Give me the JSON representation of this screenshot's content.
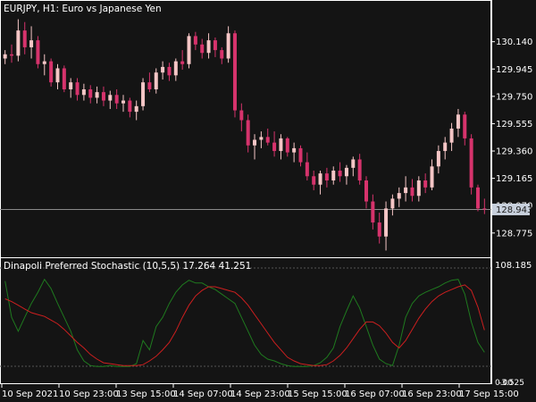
{
  "window": {
    "symbol_title": "EURJPY, H1:  Euro vs Japanese Yen"
  },
  "price_axis": {
    "labels": [
      "130.140",
      "129.945",
      "129.750",
      "129.555",
      "129.360",
      "129.165",
      "128.970",
      "128.775"
    ],
    "values": [
      130.14,
      129.945,
      129.75,
      129.555,
      129.36,
      129.165,
      128.97,
      128.775
    ],
    "current_price": "128.943",
    "current_value": 128.943
  },
  "indicator": {
    "title": "Dinapoli Preferred Stochastic (10,5,5) 17.264 41.251",
    "axis_labels": [
      "108.185",
      "0.00",
      "-3.525"
    ],
    "main_value": 17.264,
    "signal_value": 41.251
  },
  "time_axis": {
    "labels": [
      "10 Sep 2021",
      "10 Sep 23:00",
      "13 Sep 15:00",
      "14 Sep 07:00",
      "14 Sep 23:00",
      "15 Sep 15:00",
      "16 Sep 07:00",
      "16 Sep 23:00",
      "17 Sep 15:00"
    ]
  },
  "colors": {
    "background": "#141414",
    "bull_candle": "#f5c6c6",
    "bear_candle": "#d6336c",
    "main_line": "#1f7a1f",
    "signal_line": "#cc1f1f",
    "grid_line": "#555555",
    "border": "#ffffff"
  },
  "chart_data": {
    "type": "candlestick",
    "series": [
      {
        "name": "EURJPY",
        "values": [
          [
            130.02,
            130.08,
            129.98,
            130.05
          ],
          [
            130.05,
            130.12,
            129.99,
            130.04
          ],
          [
            130.04,
            130.3,
            130.0,
            130.22
          ],
          [
            130.22,
            130.28,
            130.05,
            130.1
          ],
          [
            130.1,
            130.25,
            130.02,
            130.15
          ],
          [
            130.15,
            130.18,
            129.95,
            129.98
          ],
          [
            129.98,
            130.05,
            129.9,
            130.0
          ],
          [
            130.0,
            130.02,
            129.82,
            129.85
          ],
          [
            129.85,
            129.98,
            129.8,
            129.95
          ],
          [
            129.95,
            129.97,
            129.78,
            129.8
          ],
          [
            129.8,
            129.88,
            129.74,
            129.85
          ],
          [
            129.85,
            129.88,
            129.72,
            129.76
          ],
          [
            129.76,
            129.84,
            129.72,
            129.8
          ],
          [
            129.8,
            129.83,
            129.7,
            129.74
          ],
          [
            129.74,
            129.82,
            129.7,
            129.78
          ],
          [
            129.78,
            129.82,
            129.68,
            129.72
          ],
          [
            129.72,
            129.79,
            129.66,
            129.76
          ],
          [
            129.76,
            129.8,
            129.66,
            129.7
          ],
          [
            129.7,
            129.76,
            129.64,
            129.72
          ],
          [
            129.72,
            129.74,
            129.6,
            129.64
          ],
          [
            129.64,
            129.72,
            129.58,
            129.68
          ],
          [
            129.68,
            129.88,
            129.65,
            129.85
          ],
          [
            129.85,
            129.92,
            129.78,
            129.8
          ],
          [
            129.8,
            129.95,
            129.77,
            129.92
          ],
          [
            129.92,
            130.0,
            129.87,
            129.96
          ],
          [
            129.96,
            129.99,
            129.86,
            129.9
          ],
          [
            129.9,
            130.02,
            129.86,
            130.0
          ],
          [
            130.0,
            130.08,
            129.94,
            129.98
          ],
          [
            129.98,
            130.2,
            129.95,
            130.18
          ],
          [
            130.18,
            130.21,
            130.08,
            130.12
          ],
          [
            130.12,
            130.16,
            130.02,
            130.06
          ],
          [
            130.06,
            130.2,
            130.02,
            130.15
          ],
          [
            130.15,
            130.17,
            130.03,
            130.08
          ],
          [
            130.08,
            130.1,
            129.98,
            130.02
          ],
          [
            130.02,
            130.25,
            129.99,
            130.2
          ],
          [
            130.2,
            130.22,
            129.6,
            129.65
          ],
          [
            129.65,
            129.7,
            129.5,
            129.58
          ],
          [
            129.58,
            129.62,
            129.35,
            129.4
          ],
          [
            129.4,
            129.48,
            129.3,
            129.44
          ],
          [
            129.44,
            129.5,
            129.38,
            129.46
          ],
          [
            129.46,
            129.52,
            129.4,
            129.42
          ],
          [
            129.42,
            129.5,
            129.32,
            129.36
          ],
          [
            129.36,
            129.48,
            129.3,
            129.45
          ],
          [
            129.45,
            129.46,
            129.32,
            129.35
          ],
          [
            129.35,
            129.42,
            129.28,
            129.38
          ],
          [
            129.38,
            129.4,
            129.25,
            129.28
          ],
          [
            129.28,
            129.35,
            129.15,
            129.18
          ],
          [
            129.18,
            129.22,
            129.08,
            129.12
          ],
          [
            129.12,
            129.22,
            129.05,
            129.2
          ],
          [
            129.2,
            129.24,
            129.1,
            129.15
          ],
          [
            129.15,
            129.25,
            129.12,
            129.22
          ],
          [
            129.22,
            129.28,
            129.14,
            129.18
          ],
          [
            129.18,
            129.26,
            129.12,
            129.24
          ],
          [
            129.24,
            129.32,
            129.18,
            129.3
          ],
          [
            129.3,
            129.34,
            129.12,
            129.15
          ],
          [
            129.15,
            129.18,
            128.95,
            129.0
          ],
          [
            129.0,
            129.05,
            128.8,
            128.85
          ],
          [
            128.85,
            128.92,
            128.7,
            128.75
          ],
          [
            128.75,
            129.0,
            128.65,
            128.95
          ],
          [
            128.95,
            129.05,
            128.9,
            129.02
          ],
          [
            129.02,
            129.1,
            128.96,
            129.06
          ],
          [
            129.06,
            129.18,
            129.0,
            129.1
          ],
          [
            129.1,
            129.16,
            129.0,
            129.04
          ],
          [
            129.04,
            129.18,
            129.0,
            129.15
          ],
          [
            129.15,
            129.2,
            129.06,
            129.1
          ],
          [
            129.1,
            129.3,
            129.08,
            129.25
          ],
          [
            129.25,
            129.4,
            129.2,
            129.36
          ],
          [
            129.36,
            129.46,
            129.3,
            129.42
          ],
          [
            129.42,
            129.56,
            129.36,
            129.52
          ],
          [
            129.52,
            129.66,
            129.46,
            129.62
          ],
          [
            129.62,
            129.64,
            129.4,
            129.45
          ],
          [
            129.45,
            129.48,
            129.05,
            129.1
          ],
          [
            129.1,
            129.12,
            128.93,
            128.95
          ],
          [
            128.95,
            129.02,
            128.91,
            128.943
          ]
        ]
      }
    ],
    "ylim": [
      128.64,
      130.31
    ],
    "indicator": {
      "ylim": [
        -3.525,
        108.185
      ],
      "series": [
        {
          "name": "main",
          "values": [
            94,
            55,
            40,
            55,
            70,
            82,
            96,
            86,
            70,
            55,
            40,
            20,
            8,
            3,
            2,
            2,
            3,
            2,
            2,
            2,
            5,
            30,
            20,
            45,
            55,
            70,
            82,
            90,
            95,
            92,
            92,
            88,
            85,
            80,
            75,
            70,
            55,
            40,
            25,
            15,
            10,
            8,
            5,
            3,
            2,
            2,
            2,
            3,
            6,
            12,
            22,
            45,
            62,
            78,
            65,
            45,
            25,
            10,
            5,
            3,
            25,
            55,
            70,
            78,
            82,
            85,
            88,
            92,
            95,
            96,
            80,
            50,
            28,
            17.264
          ]
        },
        {
          "name": "signal",
          "values": [
            75,
            72,
            68,
            64,
            60,
            58,
            56,
            52,
            48,
            42,
            35,
            28,
            22,
            15,
            10,
            6,
            5,
            4,
            3,
            3,
            3,
            4,
            8,
            13,
            20,
            28,
            40,
            55,
            68,
            78,
            84,
            88,
            88,
            86,
            84,
            82,
            76,
            68,
            58,
            48,
            38,
            28,
            20,
            12,
            8,
            5,
            4,
            3,
            3,
            4,
            8,
            14,
            22,
            32,
            42,
            50,
            50,
            46,
            38,
            28,
            22,
            30,
            42,
            54,
            64,
            72,
            78,
            82,
            85,
            88,
            90,
            84,
            66,
            41.251
          ]
        }
      ]
    }
  }
}
